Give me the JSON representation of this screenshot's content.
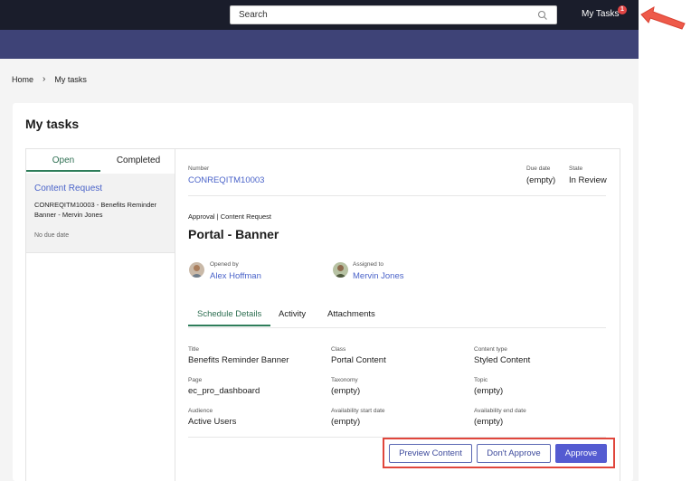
{
  "header": {
    "search_placeholder": "Search",
    "my_tasks_label": "My Tasks",
    "my_tasks_badge": "1"
  },
  "breadcrumb": {
    "home": "Home",
    "current": "My tasks"
  },
  "page": {
    "title": "My tasks"
  },
  "task_list": {
    "tabs": [
      "Open",
      "Completed"
    ],
    "active_tab": "Open",
    "items": [
      {
        "title": "Content Request",
        "description": "CONREQITM10003 - Benefits Reminder Banner - Mervin Jones",
        "due": "No due date"
      }
    ]
  },
  "record": {
    "number_label": "Number",
    "number_value": "CONREQITM10003",
    "due_label": "Due date",
    "due_value": "(empty)",
    "state_label": "State",
    "state_value": "In Review",
    "type_line": "Approval | Content Request",
    "title": "Portal - Banner",
    "opened_by_label": "Opened by",
    "opened_by_value": "Alex Hoffman",
    "assigned_to_label": "Assigned to",
    "assigned_to_value": "Mervin Jones"
  },
  "detail_tabs": [
    "Schedule Details",
    "Activity",
    "Attachments"
  ],
  "fields": {
    "title_label": "Title",
    "title_value": "Benefits Reminder Banner",
    "class_label": "Class",
    "class_value": "Portal Content",
    "content_type_label": "Content type",
    "content_type_value": "Styled Content",
    "page_label": "Page",
    "page_value": "ec_pro_dashboard",
    "taxonomy_label": "Taxonomy",
    "taxonomy_value": "(empty)",
    "topic_label": "Topic",
    "topic_value": "(empty)",
    "audience_label": "Audience",
    "audience_value": "Active Users",
    "avail_start_label": "Availability start date",
    "avail_start_value": "(empty)",
    "avail_end_label": "Availability end date",
    "avail_end_value": "(empty)"
  },
  "actions": {
    "preview": "Preview Content",
    "reject": "Don't Approve",
    "approve": "Approve"
  },
  "colors": {
    "topbar": "#1a1d2b",
    "accent_bar": "#3e4377",
    "link": "#4a63c9",
    "active_tab": "#2e7d5a",
    "primary_button": "#545bd1",
    "highlight": "#e0463c"
  }
}
